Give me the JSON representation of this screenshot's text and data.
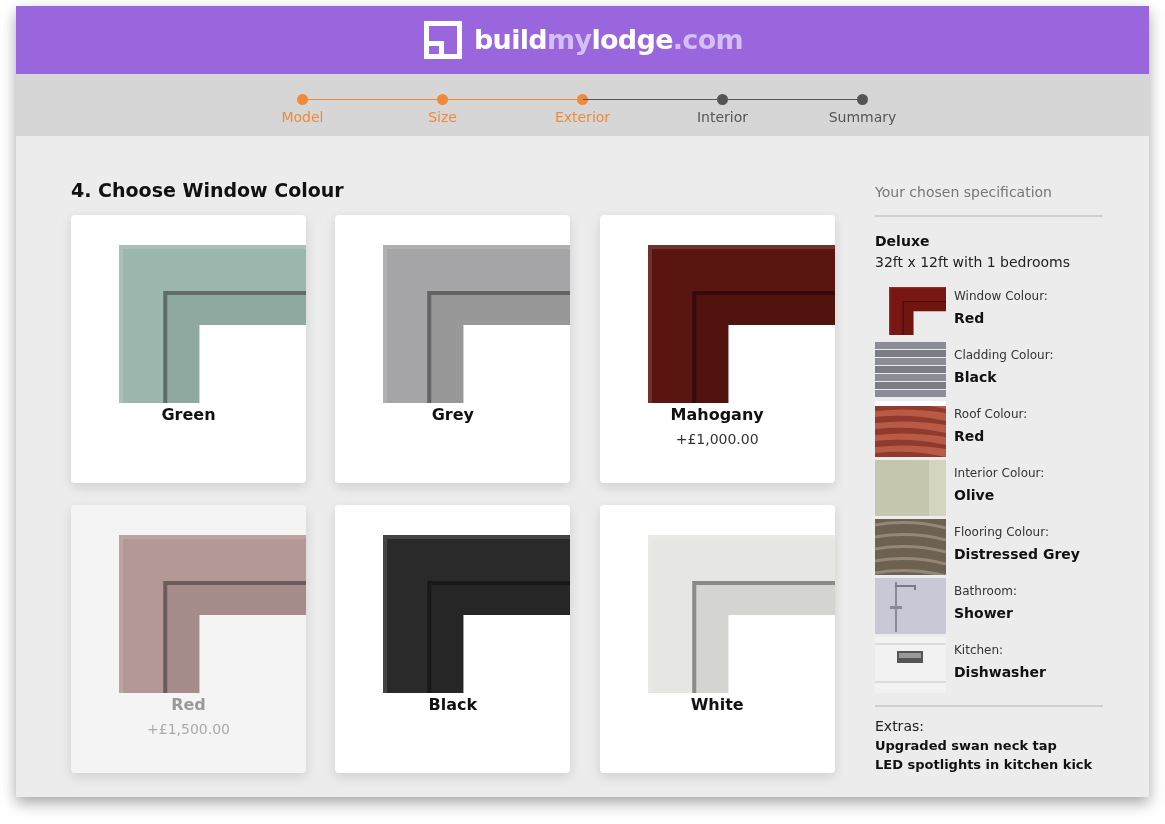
{
  "logo": {
    "parts": [
      {
        "text": "build",
        "accent": false
      },
      {
        "text": "my",
        "accent": true
      },
      {
        "text": "lodge",
        "accent": false
      },
      {
        "text": ".com",
        "accent": true
      }
    ]
  },
  "steps": [
    {
      "label": "Model",
      "done": true
    },
    {
      "label": "Size",
      "done": true
    },
    {
      "label": "Exterior",
      "done": true
    },
    {
      "label": "Interior",
      "done": false
    },
    {
      "label": "Summary",
      "done": false
    }
  ],
  "heading": "4. Choose Window Colour",
  "options": [
    {
      "name": "Green",
      "color": "#9cb8ae",
      "selected": false
    },
    {
      "name": "Grey",
      "color": "#a5a5a7",
      "selected": false
    },
    {
      "name": "Mahogany",
      "price": "+£1,000.00",
      "color": "#5a1510",
      "selected": false
    },
    {
      "name": "Red",
      "price": "+£1,500.00",
      "color": "#b39896",
      "selected": true
    },
    {
      "name": "Black",
      "color": "#2a2a2a",
      "selected": false
    },
    {
      "name": "White",
      "color": "#e6e6e2",
      "selected": false
    }
  ],
  "specification": {
    "title": "Your chosen specification",
    "model": "Deluxe",
    "size": "32ft x 12ft with 1 bedrooms",
    "items": [
      {
        "label": "Window Colour:",
        "value": "Red",
        "kind": "frame"
      },
      {
        "label": "Cladding Colour:",
        "value": "Black",
        "kind": "planks"
      },
      {
        "label": "Roof Colour:",
        "value": "Red",
        "kind": "tiles"
      },
      {
        "label": "Interior Colour:",
        "value": "Olive",
        "kind": "wall"
      },
      {
        "label": "Flooring Colour:",
        "value": "Distressed Grey",
        "kind": "wood"
      },
      {
        "label": "Bathroom:",
        "value": "Shower",
        "kind": "shower"
      },
      {
        "label": "Kitchen:",
        "value": "Dishwasher",
        "kind": "kitchen"
      }
    ],
    "extras_label": "Extras:",
    "extras": [
      "Upgraded swan neck tap",
      "LED spotlights in kitchen kick"
    ]
  }
}
